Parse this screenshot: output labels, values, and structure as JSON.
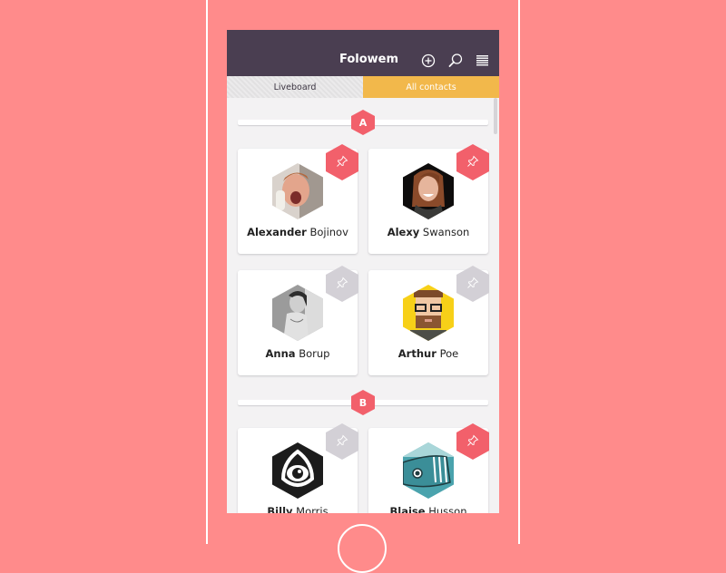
{
  "app": {
    "title": "Folowem",
    "icons": [
      "add-circle-icon",
      "search-icon",
      "menu-icon"
    ]
  },
  "tabs": [
    {
      "label": "Liveboard",
      "active": false
    },
    {
      "label": "All contacts",
      "active": true
    }
  ],
  "colors": {
    "background": "#ff8b8b",
    "header": "#4a3e51",
    "active_tab": "#f2b84b",
    "accent": "#f2606b",
    "pin_off": "#d3d0d6"
  },
  "sections": [
    {
      "letter": "A",
      "contacts": [
        {
          "first": "Alexander",
          "last": "Bojinov",
          "pinned": true,
          "avatar": "photo-man-laughing"
        },
        {
          "first": "Alexy",
          "last": "Swanson",
          "pinned": true,
          "avatar": "photo-woman-smiling"
        },
        {
          "first": "Anna",
          "last": "Borup",
          "pinned": false,
          "avatar": "photo-woman-grayscale"
        },
        {
          "first": "Arthur",
          "last": "Poe",
          "pinned": false,
          "avatar": "pixel-art-man-glasses"
        }
      ]
    },
    {
      "letter": "B",
      "contacts": [
        {
          "first": "Billy",
          "last": "Morris",
          "pinned": false,
          "avatar": "eye-logo"
        },
        {
          "first": "Blaise",
          "last": "Husson",
          "pinned": true,
          "avatar": "whale-illustration"
        }
      ]
    }
  ]
}
